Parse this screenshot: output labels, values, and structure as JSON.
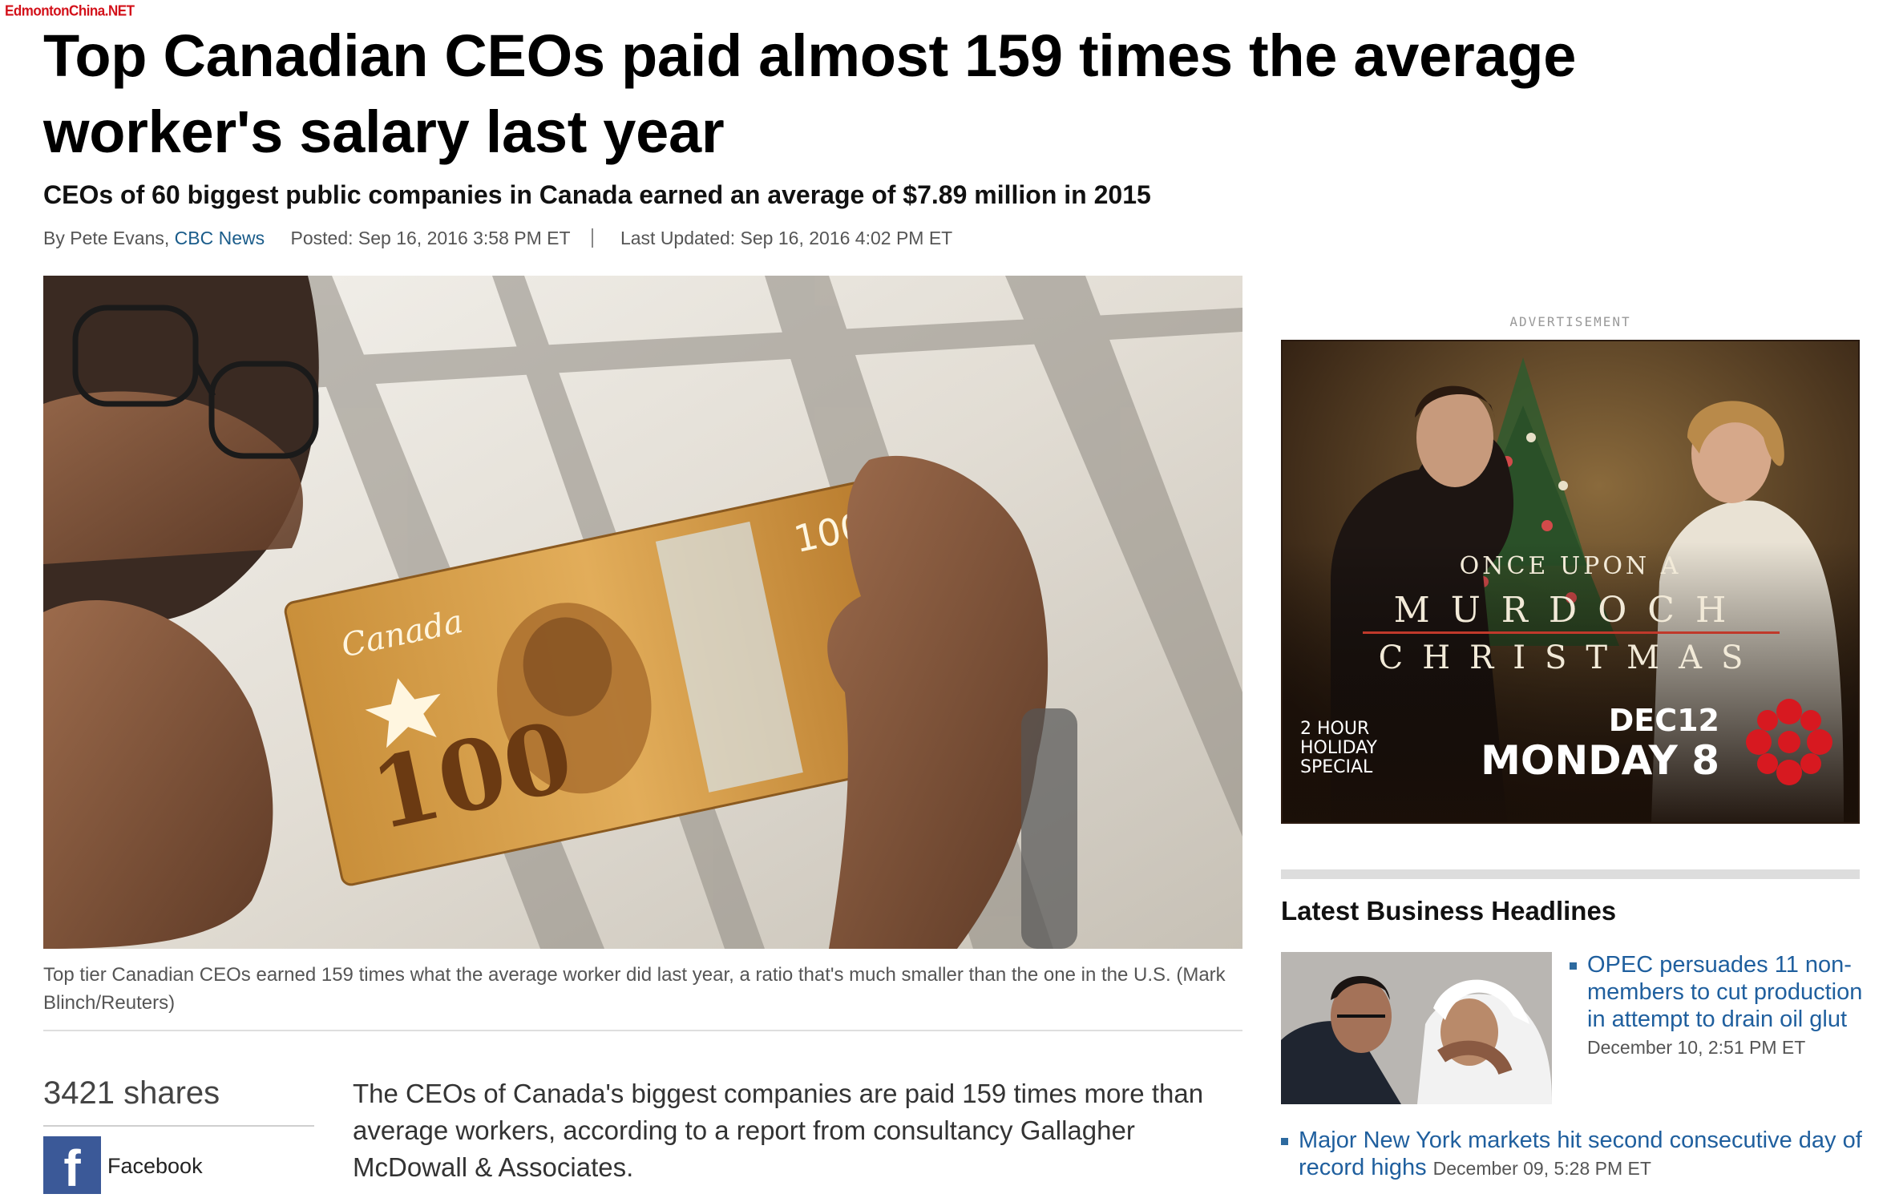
{
  "watermark": "EdmontonChina.NET",
  "article": {
    "title": "Top Canadian CEOs paid almost 159 times the average worker's salary last year",
    "subtitle": "CEOs of 60 biggest public companies in Canada earned an average of $7.89 million in 2015",
    "byline_prefix": "By Pete Evans,",
    "byline_source": "CBC News",
    "posted": "Posted: Sep 16, 2016 3:58 PM ET",
    "updated": "Last Updated: Sep 16, 2016 4:02 PM ET",
    "photo": {
      "banknote_word": "Canada",
      "banknote_value": "100"
    },
    "caption": "Top tier Canadian CEOs earned 159 times what the average worker did last year, a ratio that's much smaller than the one in the U.S. (Mark Blinch/Reuters)",
    "shares": "3421 shares",
    "facebook_icon_glyph": "f",
    "facebook_label": "Facebook",
    "body_first_paragraph": "The CEOs of Canada's biggest companies are paid 159 times more than average workers, according to a report from consultancy Gallagher McDowall & Associates."
  },
  "advertisement": {
    "label": "ADVERTISEMENT",
    "line1": "ONCE UPON A",
    "line2": "MURDOCH",
    "line3": "CHRISTMAS",
    "special_1": "2 HOUR",
    "special_2": "HOLIDAY",
    "special_3": "SPECIAL",
    "date": "DEC12",
    "day_time": "MONDAY 8",
    "brand_color": "#d71920"
  },
  "sidebar": {
    "title": "Latest Business Headlines",
    "headlines": [
      {
        "text": "OPEC persuades 11 non-members to cut production in attempt to drain oil glut",
        "date": "December 10, 2:51 PM ET"
      },
      {
        "text": "Major New York markets hit second consecutive day of record highs",
        "date": "December 09, 5:28 PM ET"
      }
    ]
  },
  "colors": {
    "link": "#1f5f9e",
    "source_link": "#1a5c8a",
    "watermark": "#d3111a",
    "facebook": "#3b5998"
  }
}
